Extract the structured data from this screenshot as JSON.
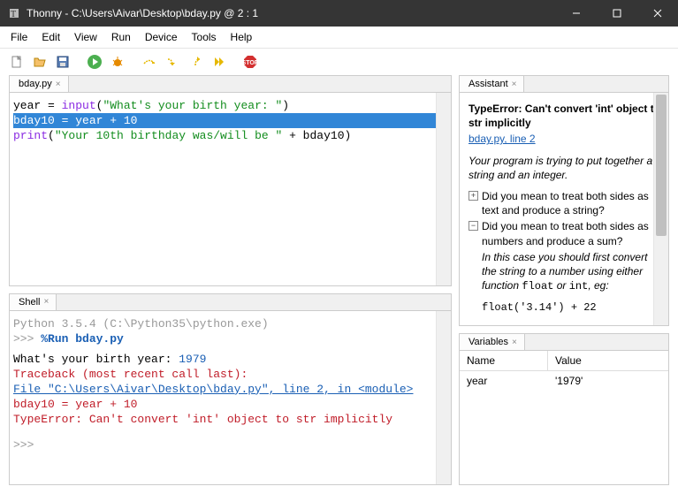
{
  "window": {
    "title": "Thonny  -  C:\\Users\\Aivar\\Desktop\\bday.py  @  2 : 1"
  },
  "menu": [
    "File",
    "Edit",
    "View",
    "Run",
    "Device",
    "Tools",
    "Help"
  ],
  "editor": {
    "tab": "bday.py",
    "lines": {
      "l1a": "year = ",
      "l1b": "input",
      "l1c": "(",
      "l1d": "\"What's your birth year: \"",
      "l1e": ")",
      "l2": "bday10 = year + 10",
      "l3a": "print",
      "l3b": "(",
      "l3c": "\"Your 10th birthday was/will be \"",
      "l3d": " + bday10)"
    }
  },
  "shell": {
    "tab": "Shell",
    "banner": "Python 3.5.4 (C:\\Python35\\python.exe)",
    "prompt1": ">>> ",
    "run": "%Run bday.py",
    "out1a": "  What's your birth year: ",
    "out1b": "1979",
    "tb1": "  Traceback (most recent call last):",
    "tb2": "    File \"C:\\Users\\Aivar\\Desktop\\bday.py\", line 2, in <module>",
    "tb3": "      bday10 = year + 10",
    "tb4": "  TypeError: Can't convert 'int' object to str implicitly",
    "prompt2": ">>> "
  },
  "assistant": {
    "tab": "Assistant",
    "title": "TypeError: Can't convert 'int' object to str implicitly",
    "link": "bday.py, line 2",
    "intro": "Your program is trying to put together a string and an integer.",
    "hint1": "Did you mean to treat both sides as text and produce a string?",
    "hint2": "Did you mean to treat both sides as numbers and produce a sum?",
    "hint2b": "In this case you should first convert the string to a number using either function ",
    "hint2c": "float",
    "hint2d": " or ",
    "hint2e": "int",
    "hint2f": ", eg:",
    "example": "float('3.14') + 22"
  },
  "variables": {
    "tab": "Variables",
    "col_name": "Name",
    "col_value": "Value",
    "rows": [
      {
        "name": "year",
        "value": "'1979'"
      }
    ]
  }
}
